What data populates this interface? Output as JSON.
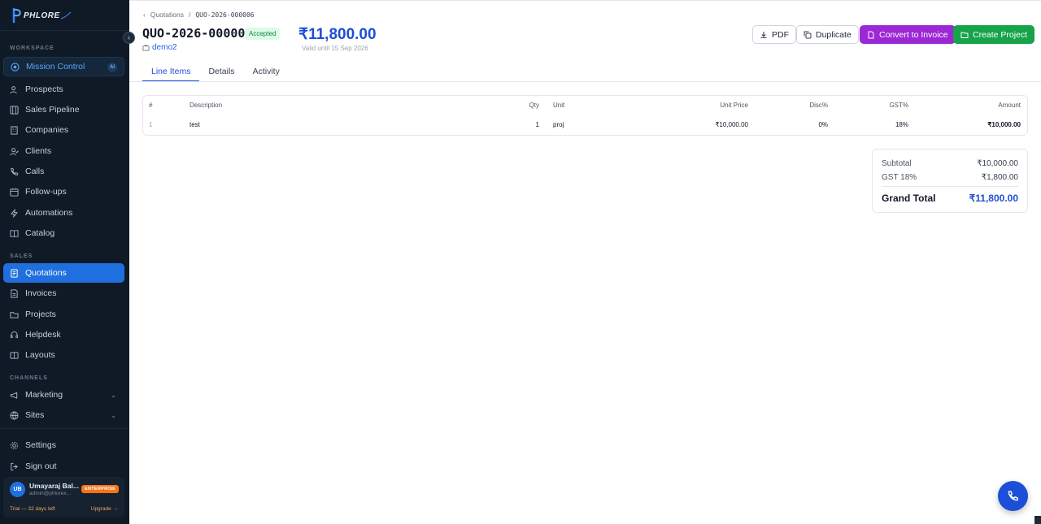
{
  "app": {
    "logo_text": "PHLORE"
  },
  "sidebar": {
    "sections": {
      "workspace": "WORKSPACE",
      "sales": "SALES",
      "channels": "CHANNELS"
    },
    "workspace_items": [
      {
        "label": "Mission Control",
        "icon": "target-icon",
        "badge": "AI"
      },
      {
        "label": "Prospects",
        "icon": "users-icon"
      },
      {
        "label": "Sales Pipeline",
        "icon": "pipeline-icon"
      },
      {
        "label": "Companies",
        "icon": "building-icon"
      },
      {
        "label": "Clients",
        "icon": "user-check-icon"
      },
      {
        "label": "Calls",
        "icon": "phone-icon"
      },
      {
        "label": "Follow-ups",
        "icon": "calendar-icon"
      },
      {
        "label": "Automations",
        "icon": "zap-icon"
      },
      {
        "label": "Catalog",
        "icon": "book-icon"
      }
    ],
    "sales_items": [
      {
        "label": "Quotations",
        "icon": "document-icon"
      },
      {
        "label": "Invoices",
        "icon": "receipt-icon"
      },
      {
        "label": "Projects",
        "icon": "folder-icon"
      },
      {
        "label": "Helpdesk",
        "icon": "headset-icon"
      },
      {
        "label": "Layouts",
        "icon": "layout-icon"
      }
    ],
    "channel_items": [
      {
        "label": "Marketing",
        "icon": "megaphone-icon"
      },
      {
        "label": "Sites",
        "icon": "globe-icon"
      }
    ],
    "bottom_items": [
      {
        "label": "Settings",
        "icon": "gear-icon"
      },
      {
        "label": "Sign out",
        "icon": "logout-icon"
      }
    ],
    "user": {
      "initials": "UB",
      "name": "Umayaraj Bal...",
      "email": "admin@phlorex...",
      "plan": "ENTERPRISE",
      "trial": "Trial — 32 days left",
      "upgrade": "Upgrade →"
    }
  },
  "header": {
    "breadcrumb_parent": "Quotations",
    "breadcrumb_sep": "/",
    "breadcrumb_current": "QUO-2026-000006",
    "title": "QUO-2026-000006",
    "status": "Accepted",
    "client": "demo2",
    "total": "₹11,800.00",
    "valid_until": "Valid until 15 Sep 2026"
  },
  "actions": {
    "pdf": "PDF",
    "duplicate": "Duplicate",
    "convert": "Convert to Invoice",
    "create_project": "Create Project"
  },
  "tabs": [
    "Line Items",
    "Details",
    "Activity"
  ],
  "table": {
    "headers": [
      "#",
      "Description",
      "Qty",
      "Unit",
      "Unit Price",
      "Disc%",
      "GST%",
      "Amount"
    ],
    "rows": [
      [
        "1",
        "test",
        "1",
        "proj",
        "₹10,000.00",
        "0%",
        "18%",
        "₹10,000.00"
      ]
    ]
  },
  "totals": {
    "subtotal_label": "Subtotal",
    "subtotal": "₹10,000.00",
    "gst_label": "GST 18%",
    "gst": "₹1,800.00",
    "grand_label": "Grand Total",
    "grand": "₹11,800.00"
  },
  "colors": {
    "sidebar_bg": "#0f1a26",
    "accent": "#1f6fde",
    "purple": "#9c27d4",
    "green": "#16a34a"
  }
}
